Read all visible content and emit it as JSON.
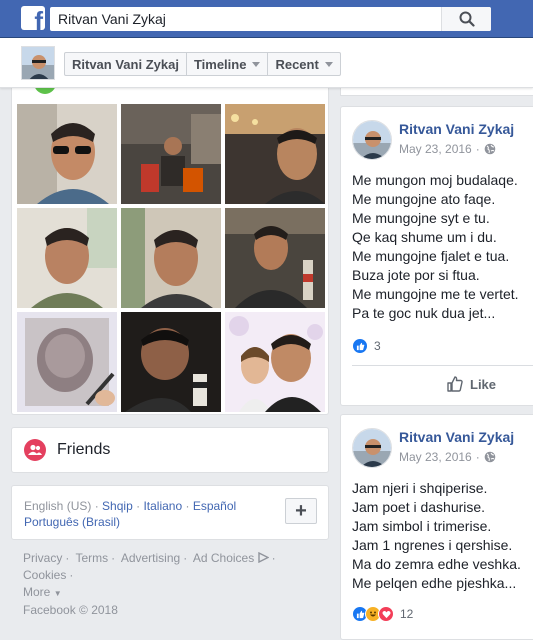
{
  "topbar": {
    "logo_letter": "f",
    "search_value": "Ritvan Vani Zykaj",
    "brand_color": "#4267b2"
  },
  "subbar": {
    "name_button": "Ritvan Vani Zykaj",
    "timeline_label": "Timeline",
    "recent_label": "Recent"
  },
  "photos": {
    "thumbnails": [
      "selfie-sunglasses",
      "man-sitting-cafe",
      "selfie-restaurant",
      "selfie-room-1",
      "selfie-room-2",
      "selfie-room-3",
      "pencil-drawing-portrait",
      "selfie-dark",
      "selfie-with-child"
    ]
  },
  "friends": {
    "label": "Friends"
  },
  "languages": {
    "current": "English (US)",
    "sep": "·",
    "links": [
      "Shqip",
      "Italiano",
      "Español",
      "Português (Brasil)"
    ],
    "more_button": "+"
  },
  "footer": {
    "links": [
      "Privacy",
      "Terms",
      "Advertising",
      "Ad Choices",
      "Cookies"
    ],
    "more": "More",
    "copyright": "Facebook © 2018"
  },
  "posts": [
    {
      "author": "Ritvan Vani Zykaj",
      "date": "May 23, 2016",
      "lines": [
        "Me mungon moj budalaqe.",
        "Me mungojne ato faqe.",
        "Me mungojne syt e tu.",
        "Qe kaq shume um i du.",
        "Me mungojne fjalet e tua.",
        "Buza jote por si ftua.",
        "Me mungojne me te vertet.",
        "Pa te goc nuk dua jet..."
      ],
      "reaction_count": "3",
      "like_label": "Like"
    },
    {
      "author": "Ritvan Vani Zykaj",
      "date": "May 23, 2016",
      "lines": [
        "Jam njeri i shqiperise.",
        "Jam poet i dashurise.",
        "Jam simbol i trimerise.",
        "Jam 1 ngrenes i qershise.",
        "Ma do zemra edhe veshka.",
        "Me pelqen edhe pjeshka..."
      ],
      "reaction_count": "12"
    }
  ],
  "colors": {
    "link": "#365899",
    "like_blue": "#1877f2",
    "love_red": "#f33e58",
    "haha_yellow": "#f7b125",
    "friends_pink": "#e4405f"
  }
}
